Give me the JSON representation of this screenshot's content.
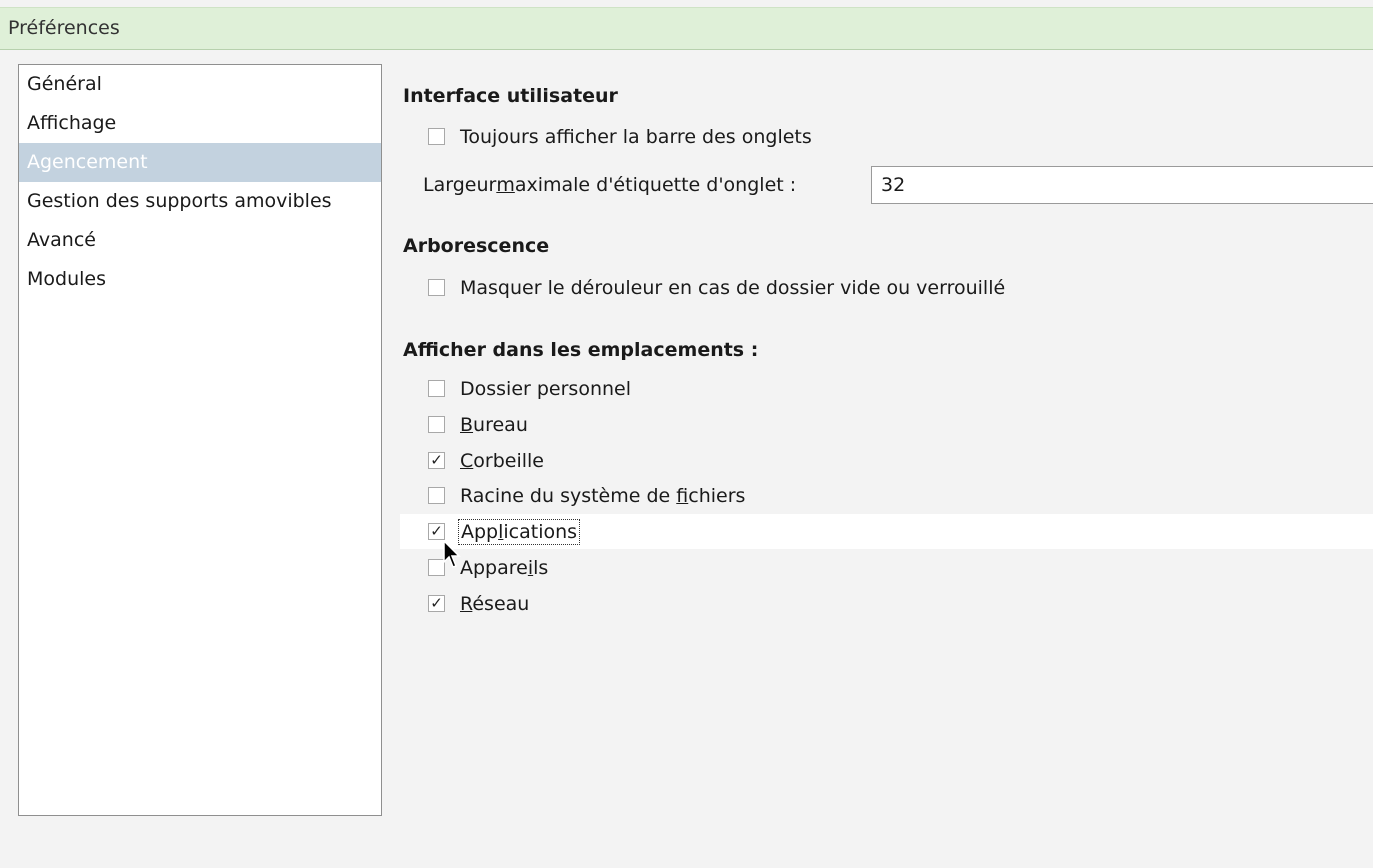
{
  "window": {
    "title": "Préférences"
  },
  "sidebar": {
    "items": [
      {
        "label": "Général",
        "selected": false
      },
      {
        "label": "Affichage",
        "selected": false
      },
      {
        "label": "Agencement",
        "selected": true
      },
      {
        "label": "Gestion des supports amovibles",
        "selected": false
      },
      {
        "label": "Avancé",
        "selected": false
      },
      {
        "label": "Modules",
        "selected": false
      }
    ]
  },
  "ui_section": {
    "heading": "Interface utilisateur",
    "always_show_tabs": {
      "label": "Toujours afficher la barre des onglets",
      "checked": false
    },
    "max_tab_label": {
      "label_pre": "Largeur ",
      "label_mnemonic": "m",
      "label_post": "aximale d'étiquette d'onglet :",
      "value": "32"
    }
  },
  "tree_section": {
    "heading": "Arborescence",
    "hide_expander": {
      "label": "Masquer le dérouleur en cas de dossier vide ou verrouillé",
      "checked": false
    }
  },
  "places_section": {
    "heading": "Afficher dans les emplacements :",
    "items": [
      {
        "pre": "Dossier personnel",
        "mn": "",
        "post": "",
        "checked": false
      },
      {
        "pre": "",
        "mn": "B",
        "post": "ureau",
        "checked": false
      },
      {
        "pre": "",
        "mn": "C",
        "post": "orbeille",
        "checked": true
      },
      {
        "pre": "Racine du système de ",
        "mn": "f",
        "post": "ichiers",
        "checked": false
      },
      {
        "pre": "App",
        "mn": "l",
        "post": "ications",
        "checked": true
      },
      {
        "pre": "Appare",
        "mn": "i",
        "post": "ls",
        "checked": false
      },
      {
        "pre": "",
        "mn": "R",
        "post": "éseau",
        "checked": true
      }
    ]
  },
  "check_glyph": "✓"
}
